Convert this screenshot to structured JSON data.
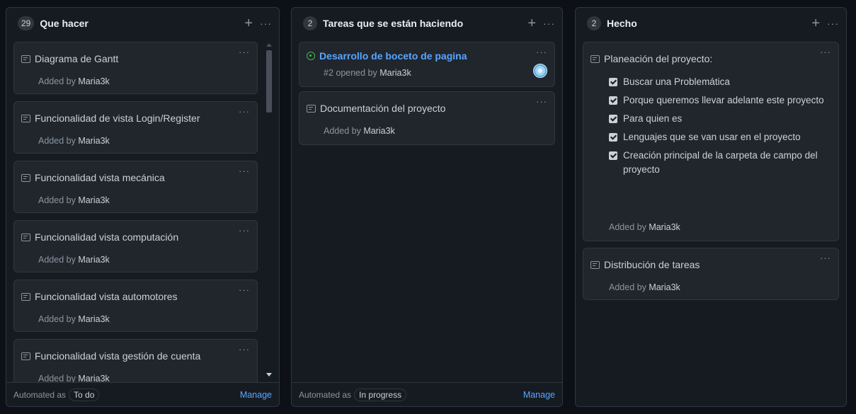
{
  "columns": [
    {
      "count": "29",
      "title": "Que hacer",
      "cards": [
        {
          "title": "Diagrama de Gantt",
          "added_prefix": "Added by",
          "user": "Maria3k"
        },
        {
          "title": "Funcionalidad de vista Login/Register",
          "added_prefix": "Added by",
          "user": "Maria3k"
        },
        {
          "title": "Funcionalidad vista mecánica",
          "added_prefix": "Added by",
          "user": "Maria3k"
        },
        {
          "title": "Funcionalidad vista computación",
          "added_prefix": "Added by",
          "user": "Maria3k"
        },
        {
          "title": "Funcionalidad vista automotores",
          "added_prefix": "Added by",
          "user": "Maria3k"
        },
        {
          "title": "Funcionalidad vista gestión de cuenta",
          "added_prefix": "Added by",
          "user": "Maria3k"
        }
      ],
      "footer": {
        "automated_label": "Automated as",
        "automated_value": "To do",
        "manage": "Manage"
      }
    },
    {
      "count": "2",
      "title": "Tareas que se están haciendo",
      "cards": [
        {
          "title": "Desarrollo de boceto de pagina",
          "issue_ref": "#2 opened by",
          "user": "Maria3k"
        },
        {
          "title": "Documentación del proyecto",
          "added_prefix": "Added by",
          "user": "Maria3k"
        }
      ],
      "footer": {
        "automated_label": "Automated as",
        "automated_value": "In progress",
        "manage": "Manage"
      }
    },
    {
      "count": "2",
      "title": "Hecho",
      "cards": [
        {
          "title": "Planeación del proyecto:",
          "checklist": [
            "Buscar una Problemática",
            "Porque queremos llevar adelante este proyecto",
            "Para quien es",
            "Lenguajes que se van usar en el proyecto",
            "Creación principal de la carpeta de campo del proyecto"
          ],
          "added_prefix": "Added by",
          "user": "Maria3k"
        },
        {
          "title": "Distribución de tareas",
          "added_prefix": "Added by",
          "user": "Maria3k"
        }
      ]
    }
  ],
  "icons": {
    "add": "+",
    "menu": "···"
  },
  "colors": {
    "background": "#0d1117",
    "column": "#161b22",
    "card": "#21262d",
    "link": "#58a6ff",
    "open_issue": "#3fb950"
  }
}
